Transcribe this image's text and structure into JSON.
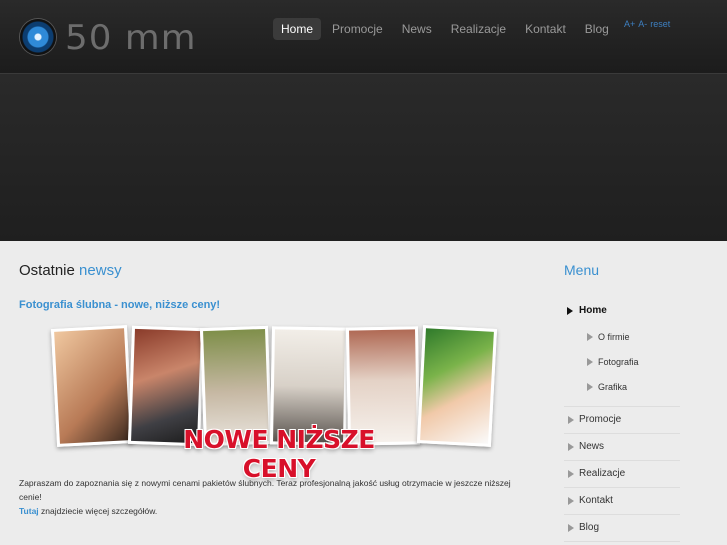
{
  "header": {
    "logo_text": "50 mm",
    "nav": [
      "Home",
      "Promocje",
      "News",
      "Realizacje",
      "Kontakt",
      "Blog"
    ],
    "font_tools": [
      "A+",
      "A-",
      "reset"
    ]
  },
  "main": {
    "section_title_plain": "Ostatnie",
    "section_title_accent": "newsy",
    "post_title": "Fotografia ślubna - nowe, niższe ceny!",
    "promo_text": "NOWE NIŻSZE CENY",
    "body_text": "Zapraszam do zapoznania się z nowymi cenami pakietów ślubnych. Teraz profesjonalną jakość usług otrzymacie w jeszcze niższej cenie!",
    "link_text": "Tutaj",
    "link_tail": " znajdziecie więcej szczegółów."
  },
  "sidebar": {
    "title": "Menu",
    "home": "Home",
    "sub_items": [
      "O firmie",
      "Fotografia",
      "Grafika"
    ],
    "items": [
      "Promocje",
      "News",
      "Realizacje",
      "Kontakt",
      "Blog"
    ]
  },
  "colors": {
    "accent": "#3a90d0",
    "promo_red": "#d8102a",
    "header_bg": "#222222"
  }
}
